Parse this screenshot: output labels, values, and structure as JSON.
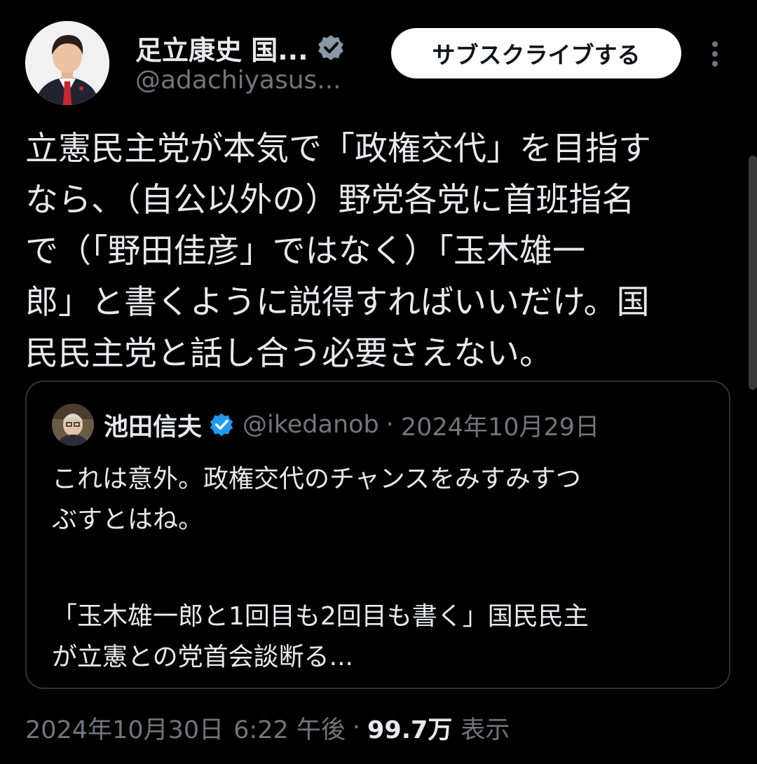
{
  "author": {
    "display_name": "足立康史 国...",
    "handle": "@adachiyasus...",
    "avatar_icon": "avatar-photo-icon",
    "verified_icon": "verified-badge-icon"
  },
  "actions": {
    "subscribe_label": "サブスクライブする",
    "more_icon": "more-vertical-icon"
  },
  "tweet": {
    "lines": [
      "立憲民主党が本気で「政権交代」を目指す",
      "なら、（自公以外の）野党各党に首班指名",
      "で（「野田佳彦」ではなく）「玉木雄一",
      "郎」と書くように説得すればいいだけ。国",
      "民民主党と話し合う必要さえない。"
    ]
  },
  "quote": {
    "display_name": "池田信夫",
    "handle": "@ikedanob",
    "separator": "·",
    "date": "2024年10月29日",
    "lines": [
      "これは意外。政権交代のチャンスをみすみすつ",
      "ぶすとはね。",
      "",
      "「玉木雄一郎と1回目も2回目も書く」国民民主",
      "が立憲との党首会談断る..."
    ]
  },
  "meta": {
    "date": "2024年10月30日",
    "time": "6:22 午後",
    "separator": "·",
    "views_count": "99.7万",
    "views_label": "表示"
  },
  "colors": {
    "background": "#000000",
    "text_primary": "#e7e9ea",
    "text_secondary": "#71767b",
    "border": "#2f3336",
    "verified_blue": "#1d9bf0",
    "button_bg": "#ffffff",
    "button_text": "#0f1419"
  }
}
